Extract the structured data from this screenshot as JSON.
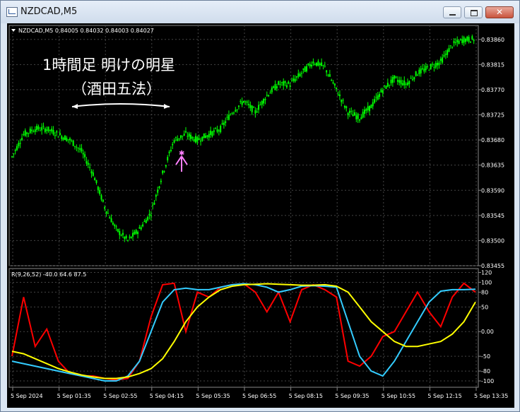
{
  "window": {
    "title": "NZDCAD,M5",
    "app_icon": "chart-window-icon",
    "controls": [
      "minimize-icon",
      "maximize-icon",
      "close-icon"
    ]
  },
  "main_chart": {
    "symbol_info": "NZDCAD,M5  0.84005 0.84032 0.84003 0.84027",
    "price_ticks": [
      "0.83860",
      "0.83815",
      "0.83770",
      "0.83725",
      "0.83680",
      "0.83635",
      "0.83590",
      "0.83545",
      "0.83500",
      "0.83455"
    ],
    "annotation_title": "1時間足 明けの明星",
    "annotation_sub": "（酒田五法）",
    "arrow_color": "#ff80ff",
    "candle_color": "#00ff00"
  },
  "indicator": {
    "info": "R(9,26,52) -40.0 64.6 87.5",
    "ticks": [
      "120",
      "100",
      "80",
      "50",
      "0.00",
      "-50",
      "-80",
      "-100"
    ],
    "line_colors": {
      "fast": "#ff0000",
      "mid": "#33ccff",
      "slow": "#ffff00"
    }
  },
  "time_axis": {
    "labels": [
      "5 Sep 2024",
      "5 Sep 01:35",
      "5 Sep 02:55",
      "5 Sep 04:15",
      "5 Sep 05:35",
      "5 Sep 06:55",
      "5 Sep 08:15",
      "5 Sep 09:35",
      "5 Sep 10:55",
      "5 Sep 12:15",
      "5 Sep 13:35"
    ]
  },
  "chart_data": {
    "type": "line",
    "title": "",
    "xlabel": "",
    "ylabel": "",
    "ylim": [
      0.83455,
      0.83885
    ],
    "x": [
      "5 Sep 2024",
      "",
      "",
      "",
      "",
      "5 Sep 01:35",
      "",
      "",
      "",
      "5 Sep 02:55",
      "",
      "",
      "",
      "5 Sep 04:15",
      "",
      "",
      "",
      "5 Sep 05:35",
      "",
      "",
      "",
      "5 Sep 06:55",
      "",
      "",
      "",
      "5 Sep 08:15",
      "",
      "",
      "",
      "5 Sep 09:35",
      "",
      "",
      "",
      "5 Sep 10:55",
      "",
      "",
      "",
      "5 Sep 12:15",
      "",
      "",
      "",
      "5 Sep 13:35"
    ],
    "series": [
      {
        "values": [
          0.8365,
          0.8369,
          0.837,
          0.837,
          0.8369,
          0.8368,
          0.8366,
          0.8362,
          0.8356,
          0.8352,
          0.835,
          0.8352,
          0.8355,
          0.8362,
          0.8368,
          0.8369,
          0.8368,
          0.8369,
          0.837,
          0.8373,
          0.8375,
          0.8373,
          0.8376,
          0.8378,
          0.8378,
          0.838,
          0.8382,
          0.8381,
          0.8377,
          0.8373,
          0.8372,
          0.8374,
          0.8377,
          0.8379,
          0.8378,
          0.838,
          0.8381,
          0.8382,
          0.8385,
          0.8386,
          0.8386
        ]
      }
    ],
    "oscillator": {
      "ylim": [
        -110,
        125
      ],
      "series": [
        {
          "values": [
            -50,
            70,
            -30,
            5,
            -60,
            -85,
            -90,
            -90,
            -95,
            -98,
            -95,
            -60,
            30,
            95,
            98,
            0,
            80,
            70,
            90,
            95,
            97,
            80,
            40,
            80,
            20,
            85,
            95,
            85,
            70,
            -60,
            -70,
            -50,
            -10,
            0,
            40,
            80,
            40,
            10,
            70,
            98,
            80
          ]
        },
        {
          "values": [
            -60,
            -65,
            -70,
            -75,
            -80,
            -85,
            -90,
            -95,
            -100,
            -100,
            -90,
            -60,
            0,
            60,
            85,
            88,
            85,
            85,
            90,
            95,
            97,
            95,
            90,
            80,
            85,
            92,
            93,
            92,
            90,
            20,
            -50,
            -80,
            -90,
            -60,
            -20,
            20,
            60,
            82,
            85,
            85,
            86
          ]
        },
        {
          "values": [
            -40,
            -45,
            -55,
            -65,
            -75,
            -82,
            -88,
            -92,
            -95,
            -95,
            -92,
            -85,
            -75,
            -55,
            -20,
            20,
            50,
            70,
            85,
            92,
            95,
            96,
            97,
            96,
            95,
            94,
            94,
            95,
            92,
            80,
            50,
            20,
            0,
            -20,
            -30,
            -30,
            -25,
            -20,
            -5,
            20,
            60
          ]
        }
      ]
    }
  }
}
